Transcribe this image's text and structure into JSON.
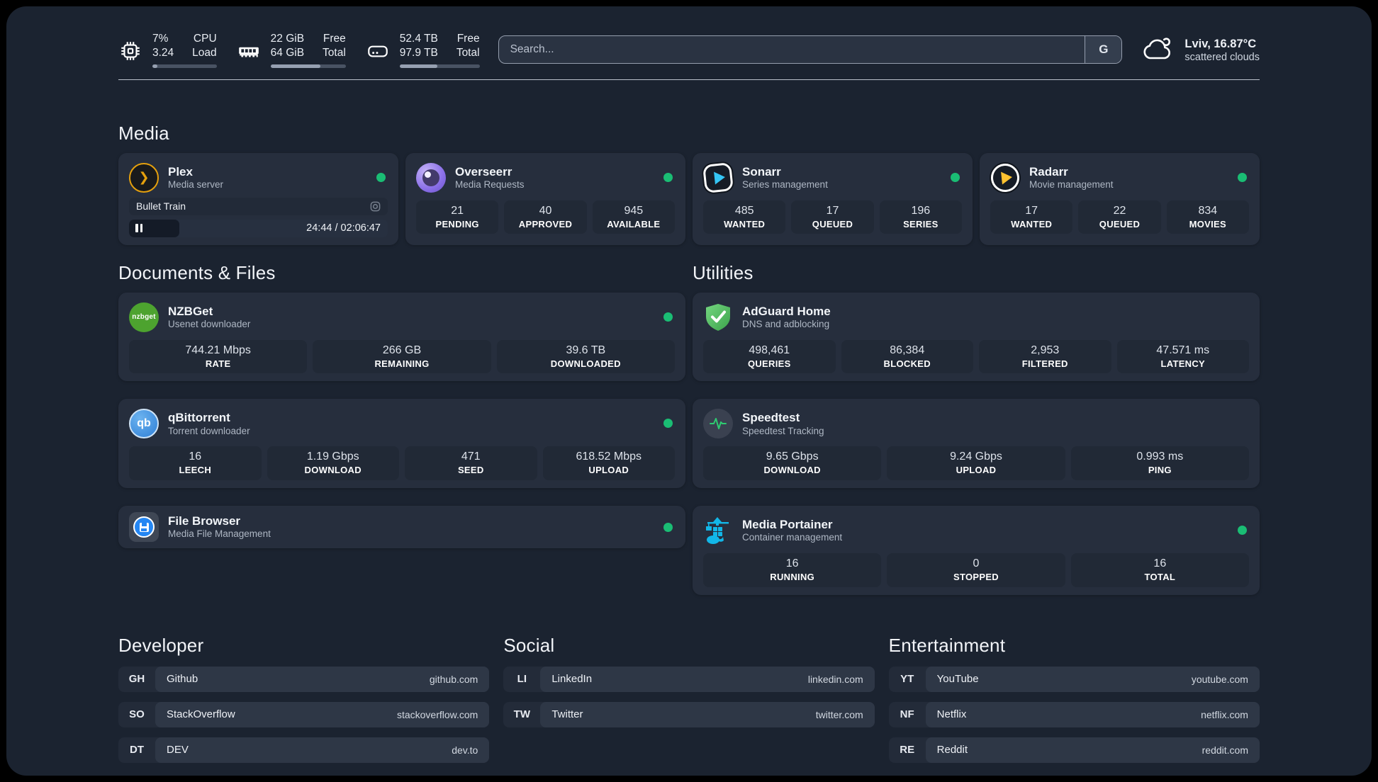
{
  "header": {
    "stats": [
      {
        "id": "cpu",
        "value1": "7%",
        "value2": "3.24",
        "label1": "CPU",
        "label2": "Load",
        "progress_pct": 8
      },
      {
        "id": "memory",
        "value1": "22 GiB",
        "value2": "64 GiB",
        "label1": "Free",
        "label2": "Total",
        "progress_pct": 66
      },
      {
        "id": "storage",
        "value1": "52.4 TB",
        "value2": "97.9 TB",
        "label1": "Free",
        "label2": "Total",
        "progress_pct": 47
      }
    ],
    "search": {
      "placeholder": "Search...",
      "engine_label": "G"
    },
    "weather": {
      "location_temp": "Lviv, 16.87°C",
      "condition": "scattered clouds"
    }
  },
  "media": {
    "title": "Media",
    "plex": {
      "name": "Plex",
      "description": "Media server",
      "now_playing": {
        "title": "Bullet Train",
        "time_display": "24:44 / 02:06:47",
        "progress_pct": 19.5
      }
    },
    "overseerr": {
      "name": "Overseerr",
      "description": "Media Requests",
      "stats": [
        {
          "value": "21",
          "label": "PENDING"
        },
        {
          "value": "40",
          "label": "APPROVED"
        },
        {
          "value": "945",
          "label": "AVAILABLE"
        }
      ]
    },
    "sonarr": {
      "name": "Sonarr",
      "description": "Series management",
      "stats": [
        {
          "value": "485",
          "label": "WANTED"
        },
        {
          "value": "17",
          "label": "QUEUED"
        },
        {
          "value": "196",
          "label": "SERIES"
        }
      ]
    },
    "radarr": {
      "name": "Radarr",
      "description": "Movie management",
      "stats": [
        {
          "value": "17",
          "label": "WANTED"
        },
        {
          "value": "22",
          "label": "QUEUED"
        },
        {
          "value": "834",
          "label": "MOVIES"
        }
      ]
    }
  },
  "documents": {
    "title": "Documents & Files",
    "nzbget": {
      "name": "NZBGet",
      "description": "Usenet downloader",
      "logo_text": "nzbget",
      "stats": [
        {
          "value": "744.21 Mbps",
          "label": "RATE"
        },
        {
          "value": "266 GB",
          "label": "REMAINING"
        },
        {
          "value": "39.6 TB",
          "label": "DOWNLOADED"
        }
      ]
    },
    "qbittorrent": {
      "name": "qBittorrent",
      "description": "Torrent downloader",
      "logo_text": "qb",
      "stats": [
        {
          "value": "16",
          "label": "LEECH"
        },
        {
          "value": "1.19 Gbps",
          "label": "DOWNLOAD"
        },
        {
          "value": "471",
          "label": "SEED"
        },
        {
          "value": "618.52 Mbps",
          "label": "UPLOAD"
        }
      ]
    },
    "filebrowser": {
      "name": "File Browser",
      "description": "Media File Management"
    }
  },
  "utilities": {
    "title": "Utilities",
    "adguard": {
      "name": "AdGuard Home",
      "description": "DNS and adblocking",
      "stats": [
        {
          "value": "498,461",
          "label": "QUERIES"
        },
        {
          "value": "86,384",
          "label": "BLOCKED"
        },
        {
          "value": "2,953",
          "label": "FILTERED"
        },
        {
          "value": "47.571 ms",
          "label": "LATENCY"
        }
      ]
    },
    "speedtest": {
      "name": "Speedtest",
      "description": "Speedtest Tracking",
      "stats": [
        {
          "value": "9.65 Gbps",
          "label": "DOWNLOAD"
        },
        {
          "value": "9.24 Gbps",
          "label": "UPLOAD"
        },
        {
          "value": "0.993 ms",
          "label": "PING"
        }
      ]
    },
    "portainer": {
      "name": "Media Portainer",
      "description": "Container management",
      "stats": [
        {
          "value": "16",
          "label": "RUNNING"
        },
        {
          "value": "0",
          "label": "STOPPED"
        },
        {
          "value": "16",
          "label": "TOTAL"
        }
      ]
    }
  },
  "links": {
    "developer": {
      "title": "Developer",
      "items": [
        {
          "prefix": "GH",
          "name": "Github",
          "url": "github.com"
        },
        {
          "prefix": "SO",
          "name": "StackOverflow",
          "url": "stackoverflow.com"
        },
        {
          "prefix": "DT",
          "name": "DEV",
          "url": "dev.to"
        }
      ]
    },
    "social": {
      "title": "Social",
      "items": [
        {
          "prefix": "LI",
          "name": "LinkedIn",
          "url": "linkedin.com"
        },
        {
          "prefix": "TW",
          "name": "Twitter",
          "url": "twitter.com"
        }
      ]
    },
    "entertainment": {
      "title": "Entertainment",
      "items": [
        {
          "prefix": "YT",
          "name": "YouTube",
          "url": "youtube.com"
        },
        {
          "prefix": "NF",
          "name": "Netflix",
          "url": "netflix.com"
        },
        {
          "prefix": "RE",
          "name": "Reddit",
          "url": "reddit.com"
        }
      ]
    }
  },
  "colors": {
    "status_online": "#1abd74",
    "plex_accent": "#e5a00d"
  }
}
